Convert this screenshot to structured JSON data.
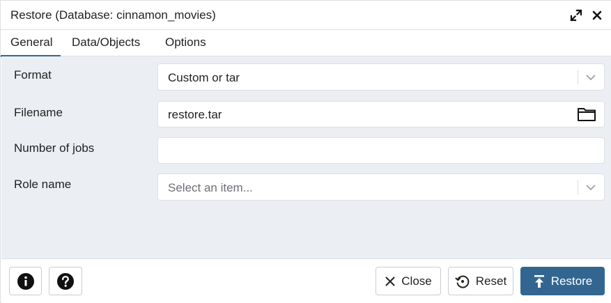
{
  "dialog": {
    "title": "Restore (Database: cinnamon_movies)"
  },
  "tabs": [
    {
      "label": "General",
      "active": true
    },
    {
      "label": "Data/Objects",
      "active": false
    },
    {
      "label": "Options",
      "active": false
    }
  ],
  "form": {
    "format": {
      "label": "Format",
      "value": "Custom or tar"
    },
    "filename": {
      "label": "Filename",
      "value": "restore.tar"
    },
    "jobs": {
      "label": "Number of jobs",
      "value": ""
    },
    "role": {
      "label": "Role name",
      "placeholder": "Select an item..."
    }
  },
  "footer": {
    "close_label": "Close",
    "reset_label": "Reset",
    "restore_label": "Restore"
  },
  "icons": {
    "maximize": "maximize-icon",
    "close": "close-icon",
    "info": "info-icon",
    "help": "help-icon",
    "folder": "folder-icon",
    "chevron": "chevron-down-icon",
    "reset": "reset-icon",
    "upload": "upload-icon"
  },
  "colors": {
    "accent": "#326690",
    "content_bg": "#ebeef3",
    "border": "#dde0e6"
  }
}
